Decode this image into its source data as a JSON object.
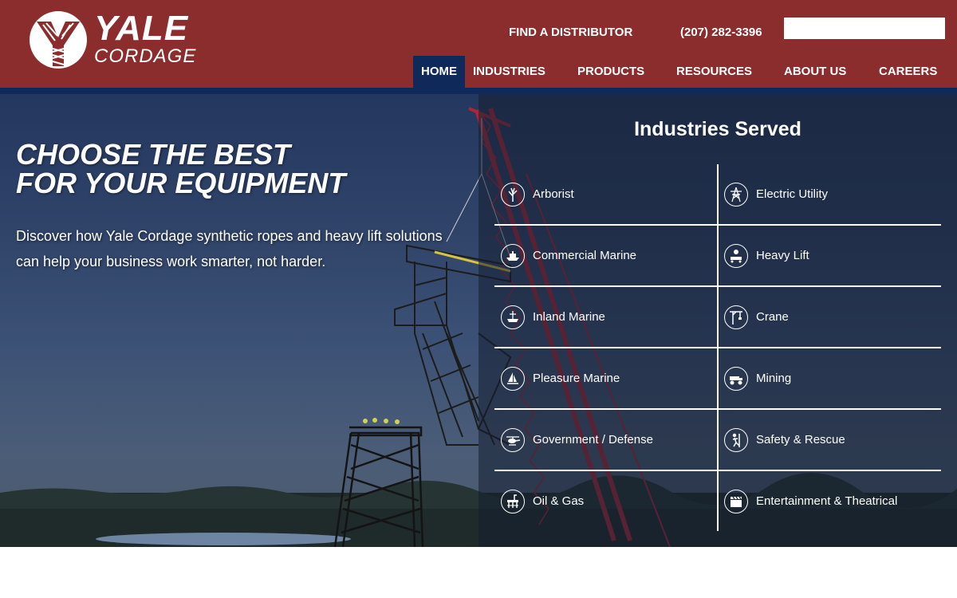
{
  "header": {
    "logo_top": "YALE",
    "logo_bottom": "CORDAGE",
    "find_distributor": "FIND A DISTRIBUTOR",
    "phone": "(207) 282-3396",
    "search_placeholder": ""
  },
  "nav": {
    "items": [
      {
        "label": "HOME",
        "active": true
      },
      {
        "label": "INDUSTRIES"
      },
      {
        "label": "PRODUCTS"
      },
      {
        "label": "RESOURCES"
      },
      {
        "label": "ABOUT US"
      },
      {
        "label": "CAREERS"
      }
    ]
  },
  "hero": {
    "title_line1": "CHOOSE THE BEST",
    "title_line2": "FOR YOUR EQUIPMENT",
    "description": "Discover how Yale Cordage synthetic ropes and heavy lift solutions can help your business work smarter, not harder."
  },
  "industries": {
    "title": "Industries Served",
    "items": [
      {
        "label": "Arborist",
        "icon": "tree-icon"
      },
      {
        "label": "Electric Utility",
        "icon": "power-tower-icon"
      },
      {
        "label": "Commercial Marine",
        "icon": "ship-icon"
      },
      {
        "label": "Heavy Lift",
        "icon": "heavy-lift-icon"
      },
      {
        "label": "Inland Marine",
        "icon": "barge-icon"
      },
      {
        "label": "Crane",
        "icon": "crane-icon"
      },
      {
        "label": "Pleasure Marine",
        "icon": "sailboat-icon"
      },
      {
        "label": "Mining",
        "icon": "mining-truck-icon"
      },
      {
        "label": "Government / Defense",
        "icon": "helicopter-icon"
      },
      {
        "label": "Safety & Rescue",
        "icon": "rescue-icon"
      },
      {
        "label": "Oil & Gas",
        "icon": "oil-rig-icon"
      },
      {
        "label": "Entertainment & Theatrical",
        "icon": "clapperboard-icon"
      }
    ]
  },
  "colors": {
    "header_red": "#8b2c2d",
    "nav_active_blue": "#0f2a5a",
    "crane_red": "#a8283a"
  }
}
